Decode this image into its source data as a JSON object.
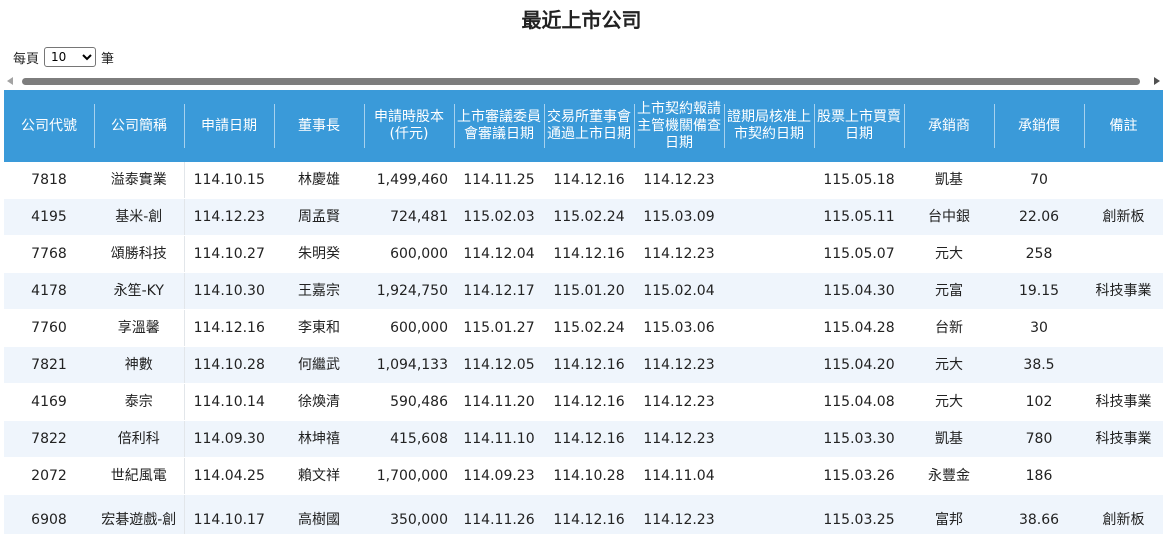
{
  "page": {
    "title": "最近上市公司"
  },
  "pager": {
    "prefix": "每頁",
    "selected": "10",
    "suffix": "筆"
  },
  "table": {
    "headers": [
      "公司代號",
      "公司簡稱",
      "申請日期",
      "董事長",
      "申請時股本(仟元)",
      "上市審議委員會審議日期",
      "交易所董事會通過上市日期",
      "上市契約報請主管機關備查日期",
      "證期局核准上市契約日期",
      "股票上市買賣日期",
      "承銷商",
      "承銷價",
      "備註"
    ],
    "rows": [
      [
        "7818",
        "溢泰實業",
        "114.10.15",
        "林慶雄",
        "1,499,460",
        "114.11.25",
        "114.12.16",
        "114.12.23",
        "",
        "115.05.18",
        "凱基",
        "70",
        ""
      ],
      [
        "4195",
        "基米-創",
        "114.12.23",
        "周孟賢",
        "724,481",
        "115.02.03",
        "115.02.24",
        "115.03.09",
        "",
        "115.05.11",
        "台中銀",
        "22.06",
        "創新板"
      ],
      [
        "7768",
        "頌勝科技",
        "114.10.27",
        "朱明癸",
        "600,000",
        "114.12.04",
        "114.12.16",
        "114.12.23",
        "",
        "115.05.07",
        "元大",
        "258",
        ""
      ],
      [
        "4178",
        "永笙-KY",
        "114.10.30",
        "王嘉宗",
        "1,924,750",
        "114.12.17",
        "115.01.20",
        "115.02.04",
        "",
        "115.04.30",
        "元富",
        "19.15",
        "科技事業"
      ],
      [
        "7760",
        "享溫馨",
        "114.12.16",
        "李東和",
        "600,000",
        "115.01.27",
        "115.02.24",
        "115.03.06",
        "",
        "115.04.28",
        "台新",
        "30",
        ""
      ],
      [
        "7821",
        "神數",
        "114.10.28",
        "何繼武",
        "1,094,133",
        "114.12.05",
        "114.12.16",
        "114.12.23",
        "",
        "115.04.20",
        "元大",
        "38.5",
        ""
      ],
      [
        "4169",
        "泰宗",
        "114.10.14",
        "徐煥清",
        "590,486",
        "114.11.20",
        "114.12.16",
        "114.12.23",
        "",
        "115.04.08",
        "元大",
        "102",
        "科技事業"
      ],
      [
        "7822",
        "倍利科",
        "114.09.30",
        "林坤禧",
        "415,608",
        "114.11.10",
        "114.12.16",
        "114.12.23",
        "",
        "115.03.30",
        "凱基",
        "780",
        "科技事業"
      ],
      [
        "2072",
        "世紀風電",
        "114.04.25",
        "賴文祥",
        "1,700,000",
        "114.09.23",
        "114.10.28",
        "114.11.04",
        "",
        "115.03.26",
        "永豐金",
        "186",
        ""
      ],
      [
        "6908",
        "宏碁遊戲-創",
        "114.10.17",
        "高樹國",
        "350,000",
        "114.11.26",
        "114.12.16",
        "114.12.23",
        "",
        "115.03.25",
        "富邦",
        "38.66",
        "創新板"
      ]
    ]
  }
}
